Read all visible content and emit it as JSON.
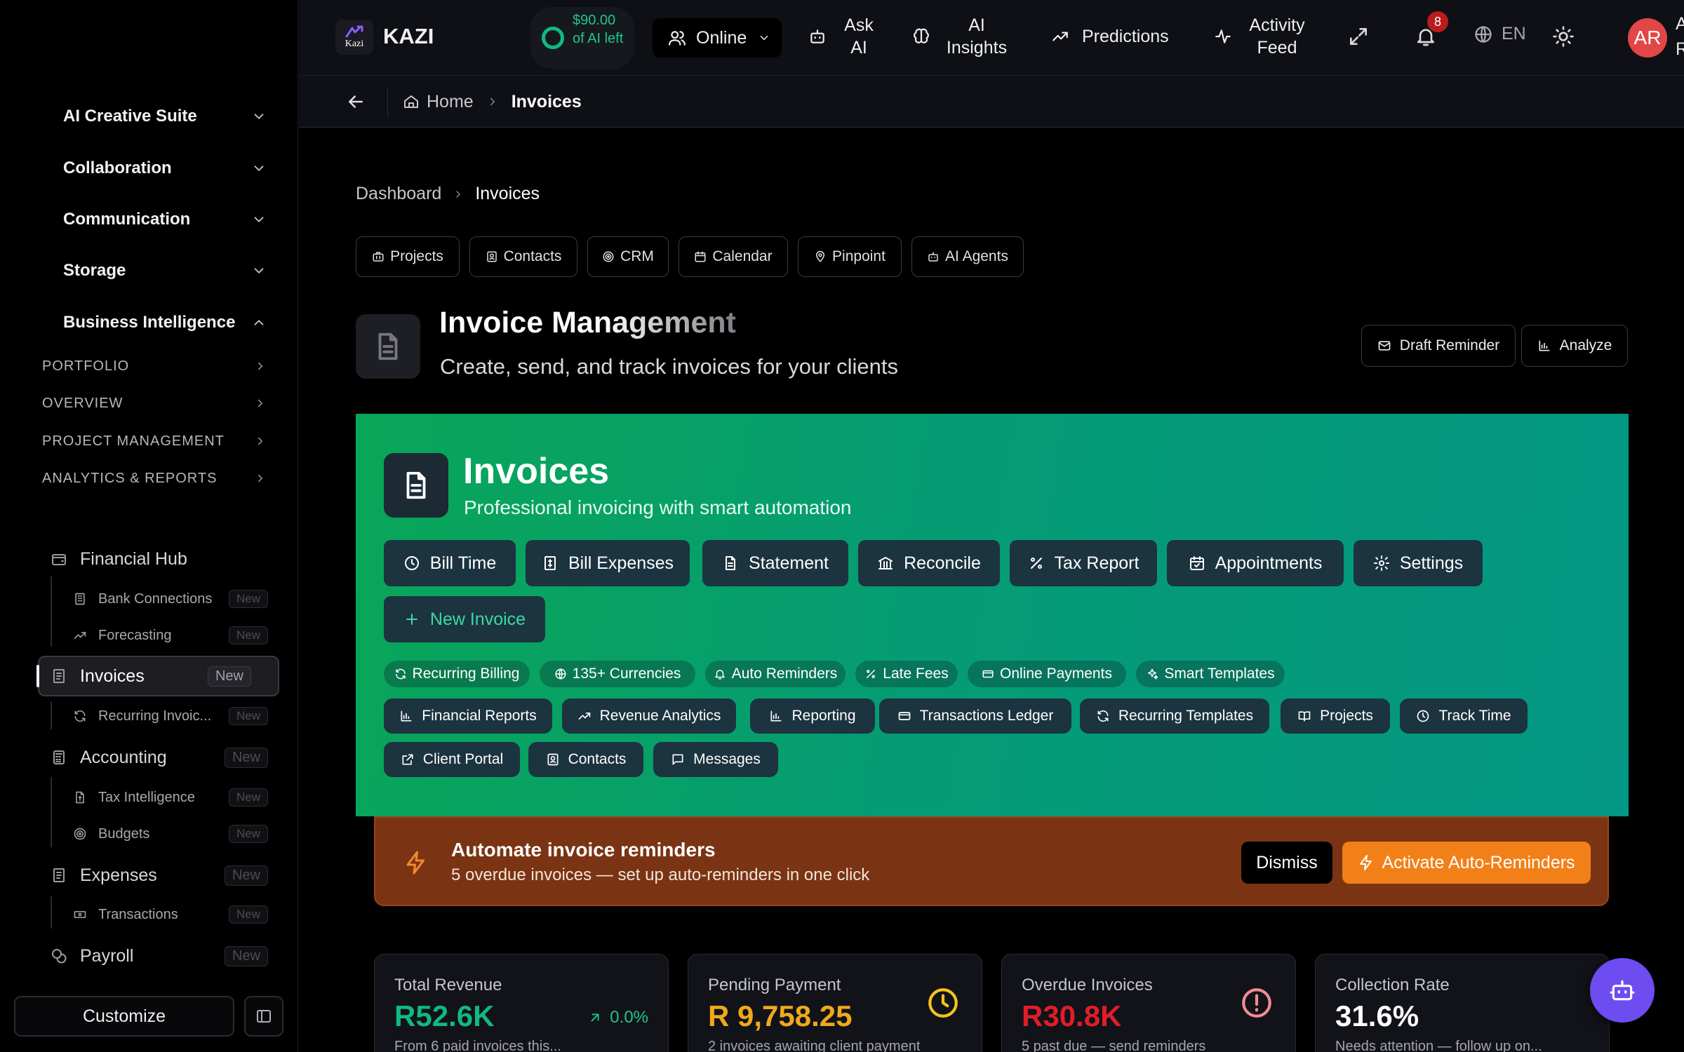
{
  "sidebar": {
    "sections": [
      {
        "label": "AI Creative Suite"
      },
      {
        "label": "Collaboration"
      },
      {
        "label": "Communication"
      },
      {
        "label": "Storage"
      },
      {
        "label": "Business Intelligence"
      }
    ],
    "bi_subsections": [
      {
        "label": "PORTFOLIO"
      },
      {
        "label": "OVERVIEW"
      },
      {
        "label": "PROJECT MANAGEMENT"
      },
      {
        "label": "ANALYTICS & REPORTS"
      }
    ],
    "items": [
      {
        "label": "Financial Hub",
        "badge": ""
      },
      {
        "label": "Bank Connections",
        "badge": "New"
      },
      {
        "label": "Forecasting",
        "badge": "New"
      },
      {
        "label": "Invoices",
        "badge": "New"
      },
      {
        "label": "Recurring Invoic...",
        "badge": "New"
      },
      {
        "label": "Accounting",
        "badge": "New"
      },
      {
        "label": "Tax Intelligence",
        "badge": "New"
      },
      {
        "label": "Budgets",
        "badge": "New"
      },
      {
        "label": "Expenses",
        "badge": "New"
      },
      {
        "label": "Transactions",
        "badge": "New"
      },
      {
        "label": "Payroll",
        "badge": "New"
      }
    ],
    "customize_label": "Customize"
  },
  "topbar": {
    "brand": "KAZI",
    "logo_text": "Kazi",
    "credits_text": "$90.00 of AI left",
    "status": "Online",
    "ask_ai": "Ask AI",
    "ai_insights": "AI Insights",
    "predictions": "Predictions",
    "activity_feed": "Activity Feed",
    "notification_count": "8",
    "language": "EN",
    "avatar_initials": "AR",
    "user_name_truncated": "A R"
  },
  "subbar": {
    "home": "Home",
    "current": "Invoices"
  },
  "main": {
    "breadcrumb": {
      "parent": "Dashboard",
      "current": "Invoices"
    },
    "quick_links": [
      "Projects",
      "Contacts",
      "CRM",
      "Calendar",
      "Pinpoint",
      "AI Agents"
    ],
    "title": "Invoice Management",
    "subtitle": "Create, send, and track invoices for your clients",
    "draft_reminder": "Draft Reminder",
    "analyze": "Analyze"
  },
  "hero": {
    "title": "Invoices",
    "subtitle": "Professional invoicing with smart automation",
    "actions": [
      "Bill Time",
      "Bill Expenses",
      "Statement",
      "Reconcile",
      "Tax Report",
      "Appointments",
      "Settings"
    ],
    "new_invoice": "New Invoice",
    "features": [
      "Recurring Billing",
      "135+ Currencies",
      "Auto Reminders",
      "Late Fees",
      "Online Payments",
      "Smart Templates"
    ],
    "quick_actions": [
      "Financial Reports",
      "Revenue Analytics",
      "Reporting",
      "Transactions Ledger",
      "Recurring Templates",
      "Projects",
      "Track Time",
      "Client Portal",
      "Contacts",
      "Messages"
    ]
  },
  "promo": {
    "title": "Automate invoice reminders",
    "subtitle": "5 overdue invoices — set up auto-reminders in one click",
    "dismiss": "Dismiss",
    "activate": "Activate Auto-Reminders"
  },
  "stats": [
    {
      "title": "Total Revenue",
      "value": "R52.6K",
      "trend": "0.0%",
      "sub": "From 6 paid invoices this...",
      "color": "#10b981"
    },
    {
      "title": "Pending Payment",
      "value": "R 9,758.25",
      "sub": "2 invoices awaiting client payment",
      "color": "#f0a81c"
    },
    {
      "title": "Overdue Invoices",
      "value": "R30.8K",
      "sub": "5 past due — send reminders",
      "color": "#e11d2a"
    },
    {
      "title": "Collection Rate",
      "value": "31.6%",
      "sub": "Needs attention — follow up on...",
      "color": "#ffffff"
    }
  ],
  "colors": {
    "accent_green": "#10b981",
    "hero_gradient_start": "#09a657",
    "hero_gradient_end": "#039785",
    "promo_bg": "#7a3413",
    "promo_button": "#f28019",
    "fab": "#6d4cf0",
    "avatar": "#e34646",
    "notification_badge": "#b91c1c"
  }
}
